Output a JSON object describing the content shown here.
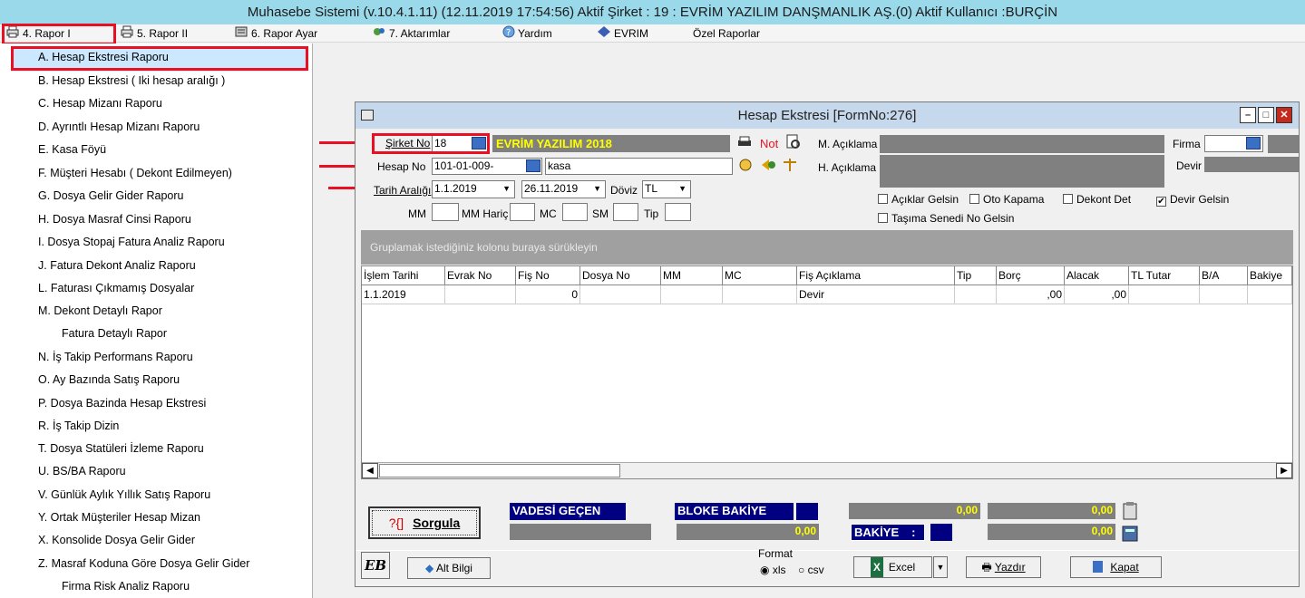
{
  "app": {
    "title": "Muhasebe Sistemi (v.10.4.1.11) (12.11.2019 17:54:56) Aktif Şirket : 19 : EVRİM YAZILIM DANŞMANLIK AŞ.(0) Aktif Kullanıcı :BURÇİN"
  },
  "menu": [
    {
      "label": "4.  Rapor I",
      "icon": "printer-icon"
    },
    {
      "label": "5.  Rapor II",
      "icon": "printer-icon"
    },
    {
      "label": "6.  Rapor Ayar",
      "icon": "printer-settings-icon"
    },
    {
      "label": "7.  Aktarımlar",
      "icon": "transfer-icon"
    },
    {
      "label": "Yardım",
      "icon": "help-icon"
    },
    {
      "label": "EVRIM",
      "icon": "evrim-logo-icon"
    },
    {
      "label": "Özel Raporlar",
      "icon": ""
    }
  ],
  "reports": [
    "A.  Hesap Ekstresi Raporu",
    "B.  Hesap Ekstresi ( Iki hesap aralığı )",
    "C.  Hesap Mizanı Raporu",
    "D.  Ayrıntlı Hesap Mizanı Raporu",
    "E.  Kasa Föyü",
    "F.  Müşteri Hesabı ( Dekont Edilmeyen)",
    "G.  Dosya Gelir Gider Raporu",
    "H.  Dosya Masraf Cinsi Raporu",
    "I.  Dosya Stopaj Fatura Analiz Raporu",
    "J.  Fatura Dekont Analiz Raporu",
    "L.  Faturası Çıkmamış Dosyalar",
    "M.  Dekont Detaylı Rapor",
    "Fatura Detaylı Rapor",
    "N.  İş Takip Performans Raporu",
    "O.  Ay Bazında Satış Raporu",
    "P.  Dosya Bazinda Hesap Ekstresi",
    "R.  İş Takip Dizin",
    "T.  Dosya Statüleri İzleme Raporu",
    "U.  BS/BA Raporu",
    "V.  Günlük Aylık Yıllık Satış Raporu",
    "Y.  Ortak Müşteriler Hesap Mizan",
    "X.  Konsolide Dosya Gelir Gider",
    "Z.  Masraf Koduna Göre Dosya Gelir Gider",
    "Firma Risk Analiz Raporu"
  ],
  "form": {
    "title": "Hesap Ekstresi [FormNo:276]",
    "sirket_label": "Şirket No",
    "sirket_value": "18",
    "sirket_name": "EVRİM YAZILIM 2018",
    "not_label": "Not",
    "m_aciklama_label": "M. Açıklama",
    "h_aciklama_label": "H. Açıklama",
    "firma_label": "Firma",
    "devir_label": "Devir",
    "hesap_label": "Hesap No",
    "hesap_value": "101-01-009-",
    "hesap_name": "kasa",
    "tarih_label": "Tarih Aralığı",
    "date_from": "1.1.2019",
    "date_to": "26.11.2019",
    "doviz_label": "Döviz",
    "doviz_value": "TL",
    "mm_label": "MM",
    "mm_haric_label": "MM Hariç",
    "mc_label": "MC",
    "sm_label": "SM",
    "tip_label": "Tip",
    "checks": [
      {
        "label": "Açıklar Gelsin",
        "checked": false
      },
      {
        "label": "Oto Kapama",
        "checked": false
      },
      {
        "label": "Dekont Det",
        "checked": false
      },
      {
        "label": "Devir Gelsin",
        "checked": true
      },
      {
        "label": "Taşıma Senedi No Gelsin",
        "checked": false
      }
    ],
    "group_hint": "Gruplamak istediğiniz kolonu buraya sürükleyin"
  },
  "grid": {
    "columns": [
      "İşlem Tarihi",
      "Evrak No",
      "Fiş No",
      "Dosya No",
      "MM",
      "MC",
      "Fiş Açıklama",
      "Tip",
      "Borç",
      "Alacak",
      "TL Tutar",
      "B/A",
      "Bakiye"
    ],
    "rows": [
      [
        "1.1.2019",
        "",
        "0",
        "",
        "",
        "",
        "Devir",
        "",
        ",00",
        ",00",
        "",
        "",
        ""
      ]
    ]
  },
  "footer": {
    "sorgula_label": "Sorgula",
    "sorgula_icon_text": "?{]",
    "vadesi_label": "VADESİ GEÇEN",
    "bloke_label": "BLOKE BAKİYE",
    "bloke_value": "0,00",
    "bakiye_label": "BAKİYE",
    "bakiye_colon": ":",
    "sum1": "0,00",
    "sum2": "0,00",
    "sum3": "0,00",
    "format_label": "Format",
    "format_xls": "xls",
    "format_csv": "csv",
    "excel_label": "Excel",
    "yazdir_label": "Yazdır",
    "kapat_label": "Kapat",
    "alt_bilgi_label": "Alt Bilgi",
    "logo_text": "EB"
  },
  "colors": {
    "accent": "#99d9ea",
    "navy": "#000080",
    "highlight": "#ffff00",
    "red": "#e81123"
  }
}
